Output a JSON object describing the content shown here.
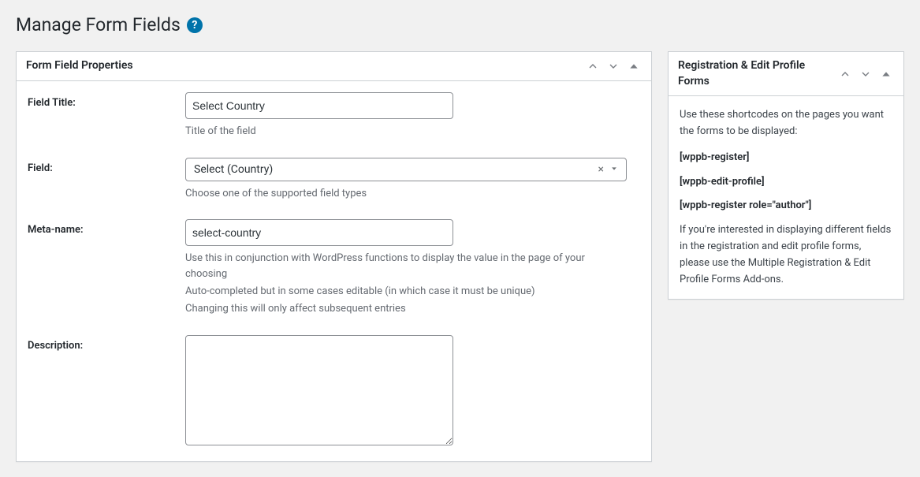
{
  "page": {
    "title": "Manage Form Fields"
  },
  "main_panel": {
    "title": "Form Field Properties",
    "fields": {
      "field_title": {
        "label": "Field Title:",
        "value": "Select Country",
        "helper": "Title of the field"
      },
      "field": {
        "label": "Field:",
        "value": "Select (Country)",
        "helper": "Choose one of the supported field types"
      },
      "meta_name": {
        "label": "Meta-name:",
        "value": "select-country",
        "helper1": "Use this in conjunction with WordPress functions to display the value in the page of your choosing",
        "helper2": "Auto-completed but in some cases editable (in which case it must be unique)",
        "helper3": "Changing this will only affect subsequent entries"
      },
      "description": {
        "label": "Description:",
        "value": ""
      }
    }
  },
  "side_panel": {
    "title": "Registration & Edit Profile Forms",
    "intro": "Use these shortcodes on the pages you want the forms to be displayed:",
    "codes": [
      "[wppb-register]",
      "[wppb-edit-profile]",
      "[wppb-register role=\"author\"]"
    ],
    "footer": "If you're interested in displaying different fields in the registration and edit profile forms, please use the Multiple Registration & Edit Profile Forms Add-ons."
  }
}
